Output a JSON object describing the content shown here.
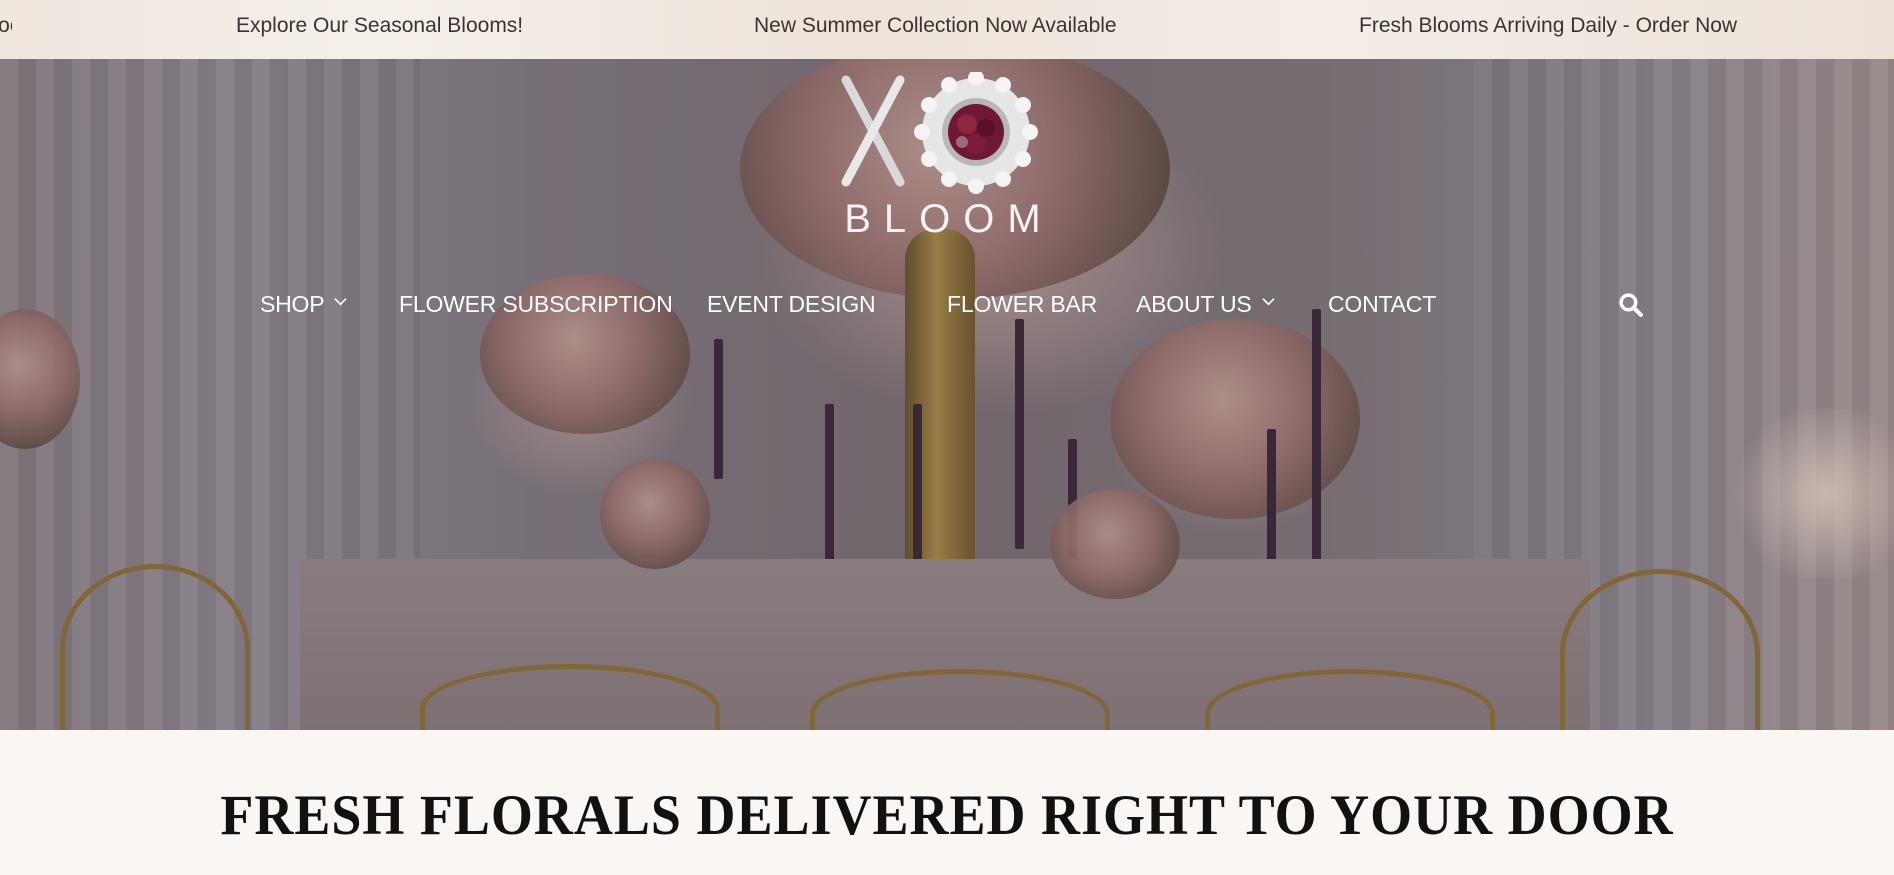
{
  "announcement_bar": {
    "messages": [
      "Fresh Blooms Arriving Daily - Order Now",
      "Explore Our Seasonal Blooms!",
      "New Summer Collection Now Available",
      "Fresh Blooms Arriving Daily - Order Now"
    ]
  },
  "logo": {
    "text": "BLOOM",
    "mark": "XO"
  },
  "nav": {
    "items": [
      {
        "label": "SHOP",
        "has_dropdown": true
      },
      {
        "label": "FLOWER SUBSCRIPTION",
        "has_dropdown": false
      },
      {
        "label": "EVENT DESIGN",
        "has_dropdown": false
      },
      {
        "label": "FLOWER BAR",
        "has_dropdown": false
      },
      {
        "label": "ABOUT US",
        "has_dropdown": true
      },
      {
        "label": "CONTACT",
        "has_dropdown": false
      }
    ],
    "search_icon": "search-icon"
  },
  "main": {
    "headline": "FRESH FLORALS DELIVERED RIGHT TO YOUR DOOR"
  },
  "colors": {
    "nav_text": "#ffffff",
    "headline_text": "#111111",
    "page_background": "#faf6f4",
    "announcement_text": "#3a3330"
  }
}
